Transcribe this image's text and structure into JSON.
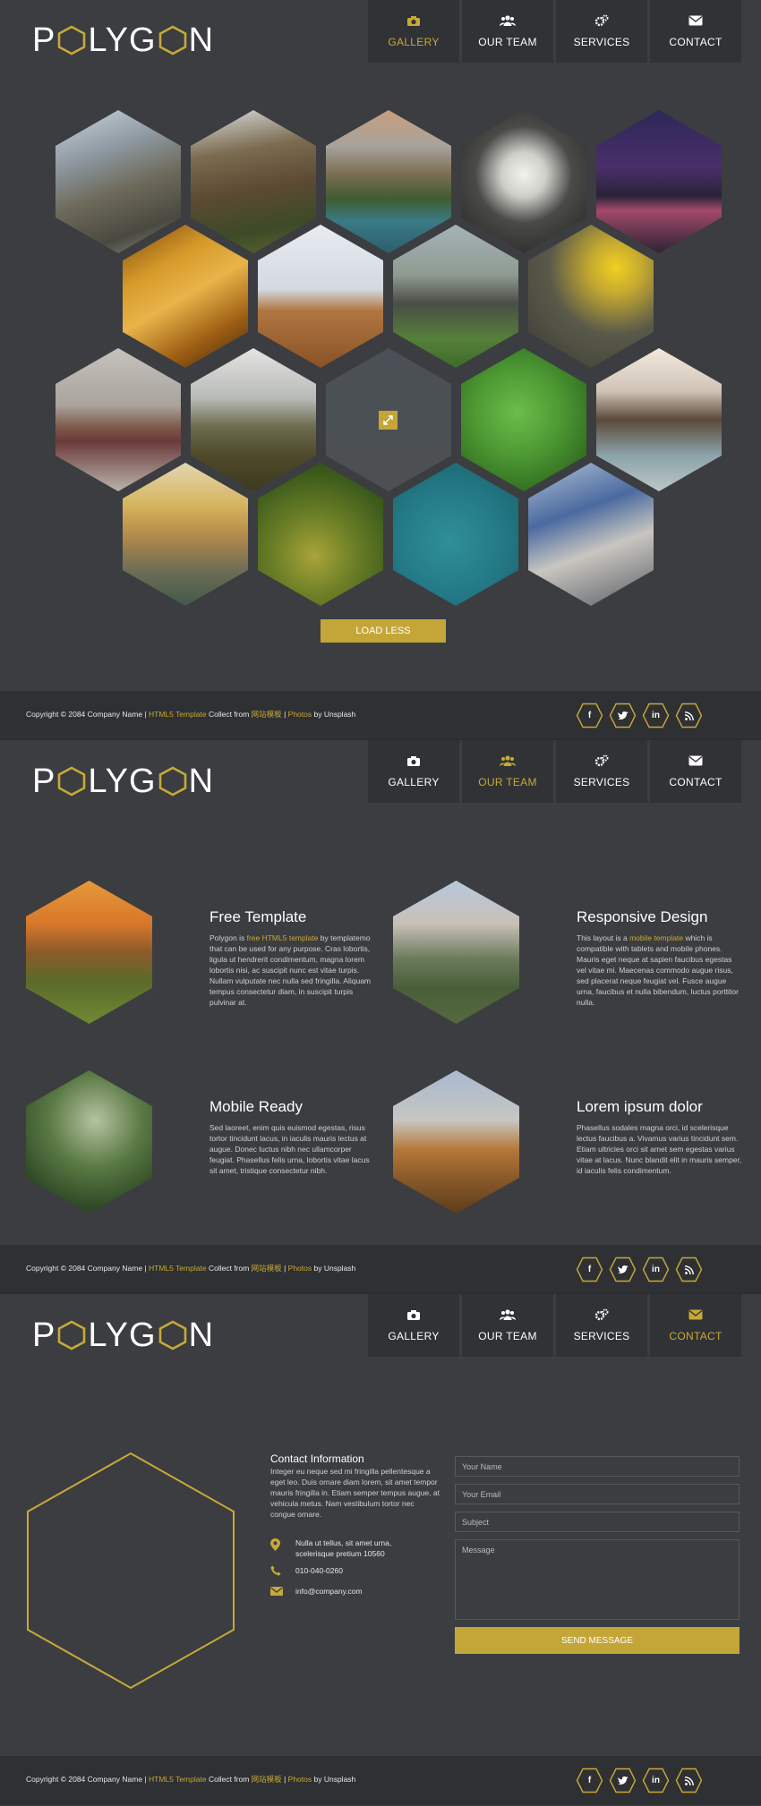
{
  "brand": {
    "logo": "POLYGON",
    "accent": "#c8a937"
  },
  "nav": [
    {
      "label": "GALLERY",
      "icon": "camera-icon"
    },
    {
      "label": "OUR TEAM",
      "icon": "users-icon"
    },
    {
      "label": "SERVICES",
      "icon": "gears-icon"
    },
    {
      "label": "CONTACT",
      "icon": "envelope-icon"
    }
  ],
  "gallery": {
    "button": "LOAD LESS"
  },
  "footer": {
    "copyright": "Copyright © 2084 Company Name |",
    "template": "HTML5 Template",
    "collect": "Collect from",
    "collect_site": "网站模板",
    "sep": "|",
    "photos": "Photos",
    "by": "by Unsplash",
    "social": [
      "f",
      "t",
      "in",
      "rss"
    ]
  },
  "features": [
    {
      "title": "Free Template",
      "text": "Polygon is free HTML5 template by templatemo that can be used for any purpose. Cras lobortis, ligula ut hendrerit condimentum, magna lorem lobortis nisi, ac suscipit nunc est vitae turpis. Nullam vulputate nec nulla sed fringilla. Aliquam tempus consectetur diam, in suscipit turpis pulvinar at."
    },
    {
      "title": "Responsive Design",
      "text": "This layout is a mobile template which is compatible with tablets and mobile phones. Mauris eget neque at sapien faucibus egestas vel vitae mi. Maecenas commodo augue risus, sed placerat neque feugiat vel. Fusce augue urna, faucibus et nulla bibendum, luctus porttitor nulla."
    },
    {
      "title": "Mobile Ready",
      "text": "Sed laoreet, enim quis euismod egestas, risus tortor tincidunt lacus, in iaculis mauris lectus at augue. Donec luctus nibh nec ullamcorper feugiat. Phasellus felis urna, lobortis vitae lacus sit amet, tristique consectetur nibh."
    },
    {
      "title": "Lorem ipsum dolor",
      "text": "Phasellus sodales magna orci, id scelerisque lectus faucibus a. Vivamus varius tincidunt sem. Etiam ultricies orci sit amet sem egestas varius vitae at lacus. Nunc blandit elit in mauris semper, id iaculis felis condimentum."
    }
  ],
  "contact": {
    "heading": "Contact Information",
    "text": "Integer eu neque sed mi fringilla pellentesque a eget leo. Duis ornare diam lorem, sit amet tempor mauris fringilla in. Etiam semper tempus augue, at vehicula metus. Nam vestibulum tortor nec congue ornare.",
    "address_line1": "Nulla ut tellus, sit amet urna,",
    "address_line2": "scelerisque pretium 10560",
    "phone": "010-040-0260",
    "email": "info@company.com",
    "form": {
      "name": "Your Name",
      "email": "Your Email",
      "subject": "Subject",
      "message": "Message",
      "submit": "SEND MESSAGE"
    }
  },
  "colors": {
    "bg": "#3b3d40",
    "panel": "#303236",
    "footer": "#2e3033",
    "gold": "#c4a638"
  }
}
